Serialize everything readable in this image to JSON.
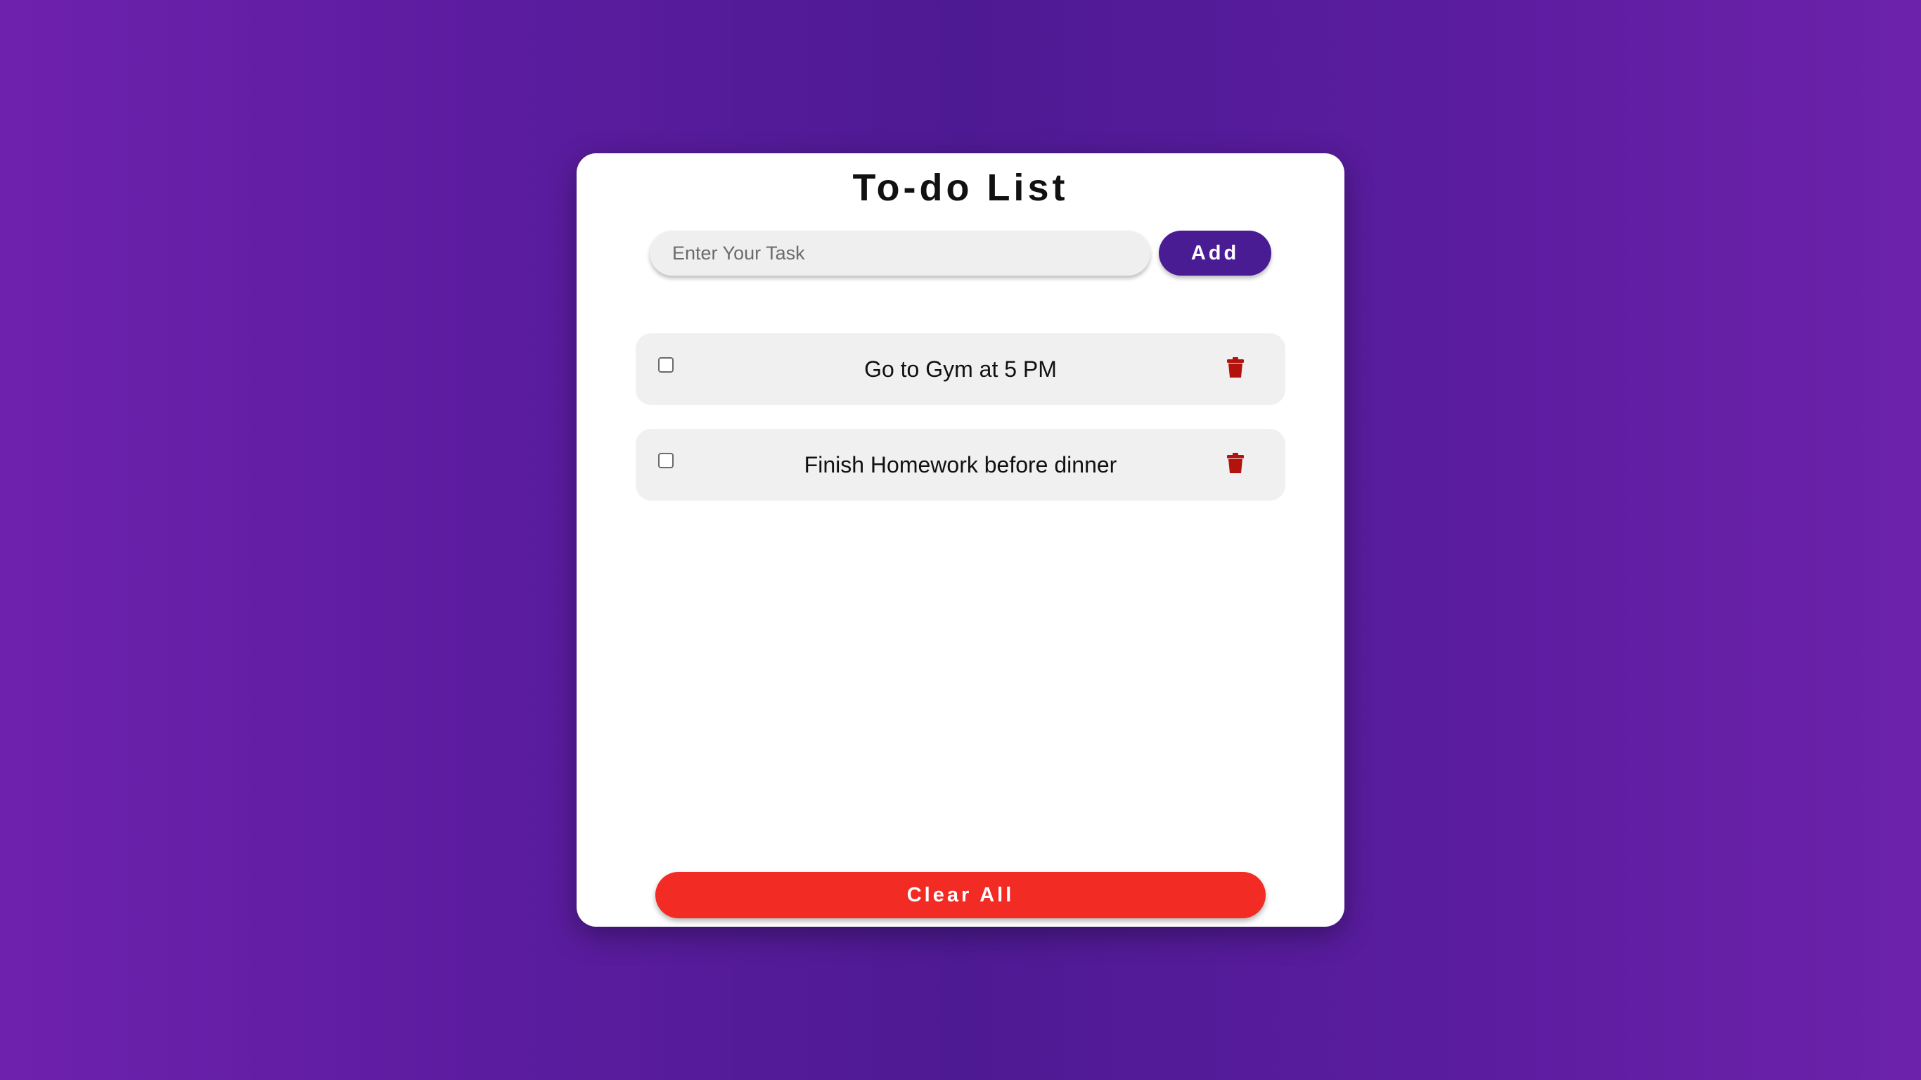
{
  "app": {
    "title": "To-do List"
  },
  "input": {
    "placeholder": "Enter Your Task",
    "value": ""
  },
  "buttons": {
    "add_label": "Add",
    "clear_label": "Clear All"
  },
  "tasks": [
    {
      "text": "Go to Gym at 5 PM",
      "checked": false,
      "delete_icon": "trash-icon"
    },
    {
      "text": "Finish Homework before dinner",
      "checked": false,
      "delete_icon": "trash-icon"
    }
  ],
  "colors": {
    "accent": "#4a1c94",
    "danger": "#f22b24",
    "trash": "#b3120d",
    "background_start": "#6e21ad",
    "background_center": "#4e1a93"
  }
}
